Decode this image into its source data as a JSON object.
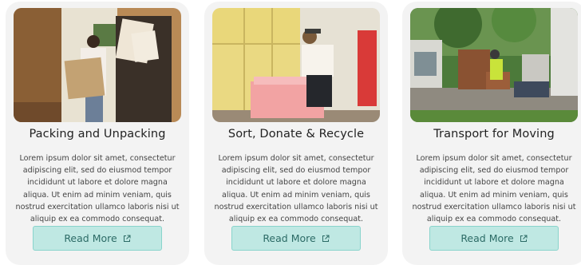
{
  "cards": [
    {
      "title": "Packing and Unpacking",
      "body": "Lorem ipsum dolor sit amet, consectetur adipiscing elit, sed do eiusmod tempor incididunt ut labore et dolore magna aliqua. Ut enim ad minim veniam, quis nostrud exercitation ullamco laboris nisi ut aliquip ex ea commodo consequat.",
      "button": "Read More",
      "icon": "external-link-icon"
    },
    {
      "title": "Sort, Donate & Recycle",
      "body": "Lorem ipsum dolor sit amet, consectetur adipiscing elit, sed do eiusmod tempor incididunt ut labore et dolore magna aliqua. Ut enim ad minim veniam, quis nostrud exercitation ullamco laboris nisi ut aliquip ex ea commodo consequat.",
      "button": "Read More",
      "icon": "external-link-icon"
    },
    {
      "title": "Transport for Moving",
      "body": "Lorem ipsum dolor sit amet, consectetur adipiscing elit, sed do eiusmod tempor incididunt ut labore et dolore magna aliqua. Ut enim ad minim veniam, quis nostrud exercitation ullamco laboris nisi ut aliquip ex ea commodo consequat.",
      "button": "Read More",
      "icon": "external-link-icon"
    }
  ],
  "colors": {
    "card_bg": "#f3f3f3",
    "button_bg": "#bfe8e3",
    "button_border": "#89d4cc",
    "button_text": "#2c6b66"
  }
}
